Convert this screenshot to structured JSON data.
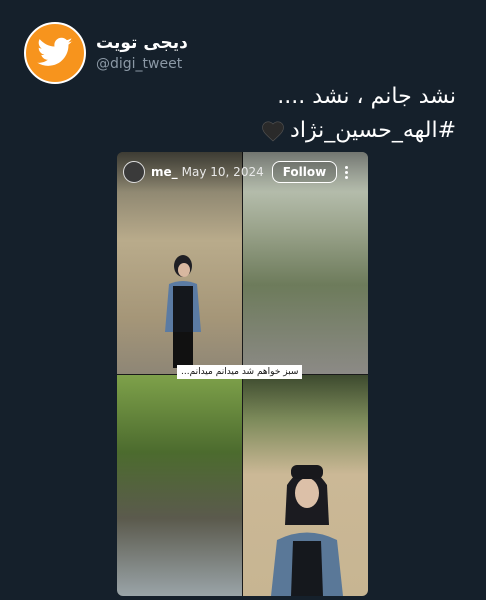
{
  "account": {
    "display_name": "دیجی تویت",
    "handle": "@digi_tweet"
  },
  "tweet": {
    "line1": "نشد جانم ، نشد ....",
    "line2": "#الهه_حسین_نژاد"
  },
  "story": {
    "username": "me_",
    "date": "May 10, 2024",
    "follow_label": "Follow",
    "caption": "سبز خواهم شد میدانم میدانم..."
  },
  "colors": {
    "background": "#15202b",
    "avatar_orange": "#f7941d",
    "handle_gray": "#8b98a5"
  },
  "icons": {
    "avatar": "bird-icon",
    "heart": "black-heart-icon",
    "more": "more-vertical-icon"
  }
}
